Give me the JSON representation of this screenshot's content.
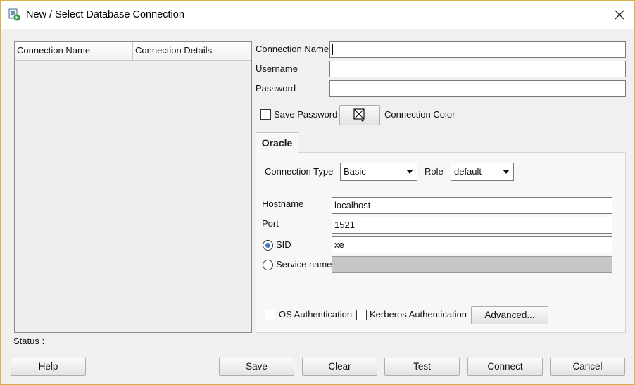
{
  "window": {
    "title": "New / Select Database Connection"
  },
  "connections_table": {
    "columns": [
      "Connection Name",
      "Connection Details"
    ],
    "rows": []
  },
  "form": {
    "connection_name": {
      "label": "Connection Name",
      "value": ""
    },
    "username": {
      "label": "Username",
      "value": ""
    },
    "password": {
      "label": "Password",
      "value": ""
    },
    "save_password": {
      "label": "Save Password",
      "checked": false
    },
    "connection_color": {
      "label": "Connection Color"
    }
  },
  "tabs": [
    {
      "label": "Oracle",
      "selected": true
    }
  ],
  "oracle": {
    "connection_type": {
      "label": "Connection Type",
      "value": "Basic"
    },
    "role": {
      "label": "Role",
      "value": "default"
    },
    "hostname": {
      "label": "Hostname",
      "value": "localhost"
    },
    "port": {
      "label": "Port",
      "value": "1521"
    },
    "sid": {
      "label": "SID",
      "value": "xe",
      "selected": true
    },
    "service_name": {
      "label": "Service name",
      "value": "",
      "selected": false
    },
    "os_auth": {
      "label": "OS Authentication",
      "checked": false
    },
    "kerberos_auth": {
      "label": "Kerberos Authentication",
      "checked": false
    },
    "advanced_label": "Advanced..."
  },
  "status": {
    "label": "Status :",
    "text": ""
  },
  "buttons": {
    "help": "Help",
    "save": "Save",
    "clear": "Clear",
    "test": "Test",
    "connect": "Connect",
    "cancel": "Cancel"
  },
  "icons": {
    "title": "database-connection-icon",
    "close": "close-icon",
    "color_picker": "color-swatch-icon",
    "dropdown": "chevron-down-icon"
  },
  "colors": {
    "accent": "#3a78c4",
    "window_border": "#d7b24a",
    "dialog_bg": "#f0f0f0"
  }
}
